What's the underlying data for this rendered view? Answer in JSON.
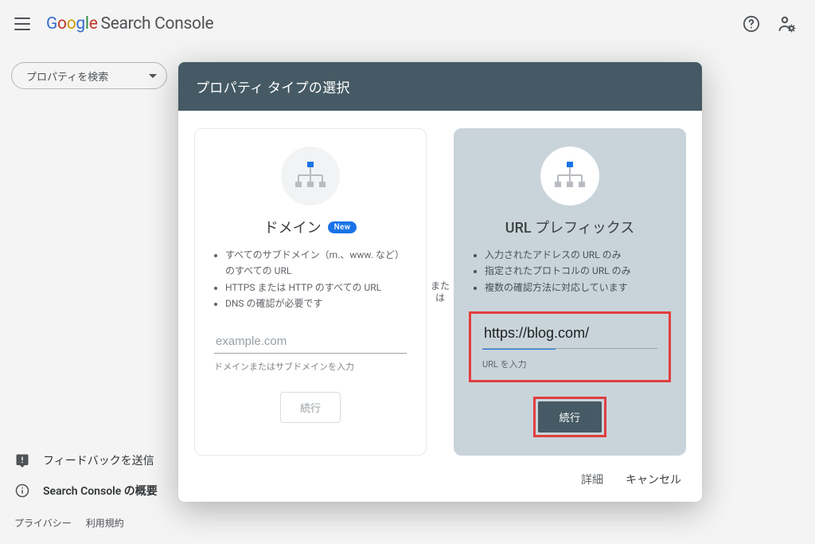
{
  "header": {
    "product_suffix": "Search Console"
  },
  "sidebar": {
    "search_placeholder": "プロパティを検索",
    "feedback_label": "フィードバックを送信",
    "about_label": "Search Console の概要"
  },
  "footer_links": {
    "privacy": "プライバシー",
    "terms": "利用規約"
  },
  "modal": {
    "title": "プロパティ タイプの選択",
    "separator": "または",
    "left": {
      "title": "ドメイン",
      "new_badge": "New",
      "bullets": [
        "すべてのサブドメイン（m.、www. など）のすべての URL",
        "HTTPS または HTTP のすべての URL",
        "DNS の確認が必要です"
      ],
      "input_placeholder": "example.com",
      "input_help": "ドメインまたはサブドメインを入力",
      "continue_label": "続行"
    },
    "right": {
      "title": "URL プレフィックス",
      "bullets": [
        "入力されたアドレスの URL のみ",
        "指定されたプロトコルの URL のみ",
        "複数の確認方法に対応しています"
      ],
      "input_value": "https://blog.com/",
      "input_help": "URL を入力",
      "continue_label": "続行"
    },
    "footer": {
      "details": "詳細",
      "cancel": "キャンセル"
    }
  }
}
